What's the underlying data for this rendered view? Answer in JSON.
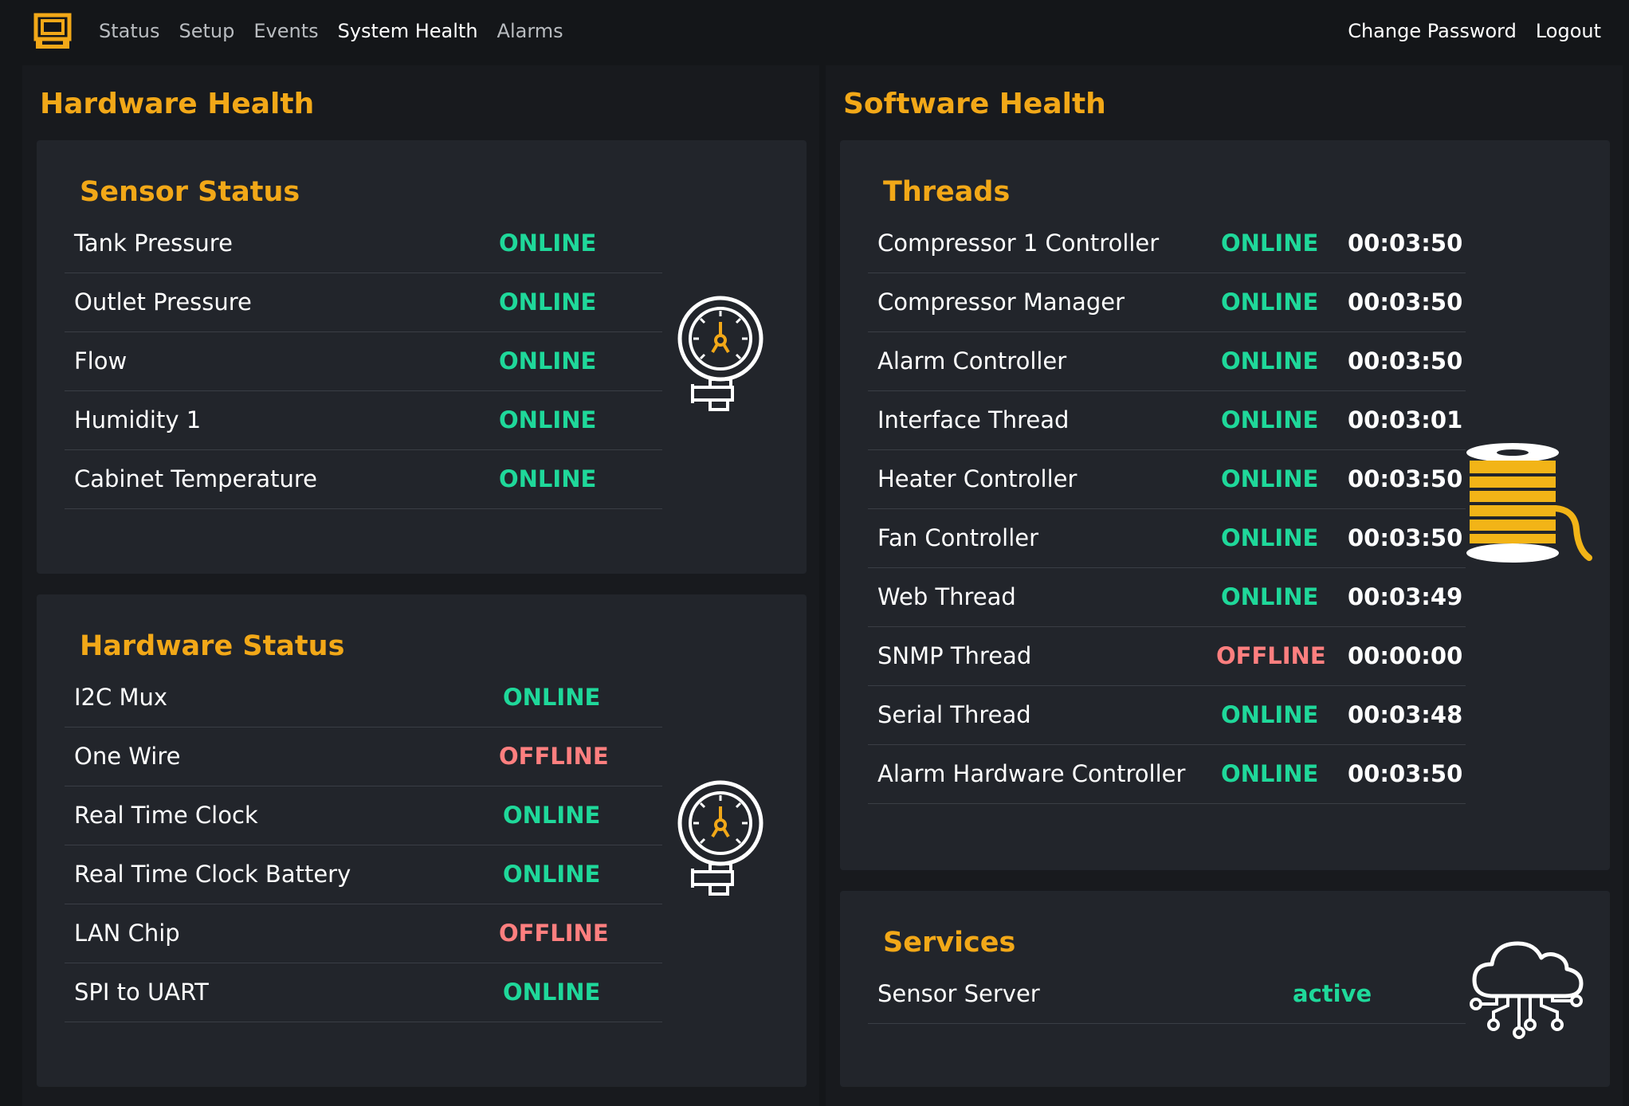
{
  "nav": {
    "items": [
      {
        "label": "Status",
        "active": false
      },
      {
        "label": "Setup",
        "active": false
      },
      {
        "label": "Events",
        "active": false
      },
      {
        "label": "System Health",
        "active": true
      },
      {
        "label": "Alarms",
        "active": false
      }
    ],
    "change_password": "Change Password",
    "logout": "Logout"
  },
  "hardware_health": {
    "title": "Hardware Health",
    "sensor_status": {
      "title": "Sensor Status",
      "rows": [
        {
          "label": "Tank Pressure",
          "status": "ONLINE"
        },
        {
          "label": "Outlet Pressure",
          "status": "ONLINE"
        },
        {
          "label": "Flow",
          "status": "ONLINE"
        },
        {
          "label": "Humidity 1",
          "status": "ONLINE"
        },
        {
          "label": "Cabinet Temperature",
          "status": "ONLINE"
        }
      ]
    },
    "hardware_status": {
      "title": "Hardware Status",
      "rows": [
        {
          "label": "I2C Mux",
          "status": "ONLINE"
        },
        {
          "label": "One Wire",
          "status": "OFFLINE"
        },
        {
          "label": "Real Time Clock",
          "status": "ONLINE"
        },
        {
          "label": "Real Time Clock Battery",
          "status": "ONLINE"
        },
        {
          "label": "LAN Chip",
          "status": "OFFLINE"
        },
        {
          "label": "SPI to UART",
          "status": "ONLINE"
        }
      ]
    }
  },
  "software_health": {
    "title": "Software Health",
    "threads": {
      "title": "Threads",
      "rows": [
        {
          "label": "Compressor 1 Controller",
          "status": "ONLINE",
          "time": "00:03:50"
        },
        {
          "label": "Compressor Manager",
          "status": "ONLINE",
          "time": "00:03:50"
        },
        {
          "label": "Alarm Controller",
          "status": "ONLINE",
          "time": "00:03:50"
        },
        {
          "label": "Interface Thread",
          "status": "ONLINE",
          "time": "00:03:01"
        },
        {
          "label": "Heater Controller",
          "status": "ONLINE",
          "time": "00:03:50"
        },
        {
          "label": "Fan Controller",
          "status": "ONLINE",
          "time": "00:03:50"
        },
        {
          "label": "Web Thread",
          "status": "ONLINE",
          "time": "00:03:49"
        },
        {
          "label": "SNMP Thread",
          "status": "OFFLINE",
          "time": "00:00:00"
        },
        {
          "label": "Serial Thread",
          "status": "ONLINE",
          "time": "00:03:48"
        },
        {
          "label": "Alarm Hardware Controller",
          "status": "ONLINE",
          "time": "00:03:50"
        }
      ]
    },
    "services": {
      "title": "Services",
      "rows": [
        {
          "label": "Sensor Server",
          "status": "active"
        }
      ]
    }
  },
  "colors": {
    "accent": "#f2a818",
    "online": "#1fd89a",
    "offline": "#ff7f7f",
    "background": "#141619",
    "card": "#22252b"
  },
  "icons": {
    "logo": "brand-logo-icon",
    "sensor": "pressure-gauge-icon",
    "hardware": "pressure-gauge-icon",
    "threads": "thread-spool-icon",
    "services": "cloud-network-icon"
  }
}
